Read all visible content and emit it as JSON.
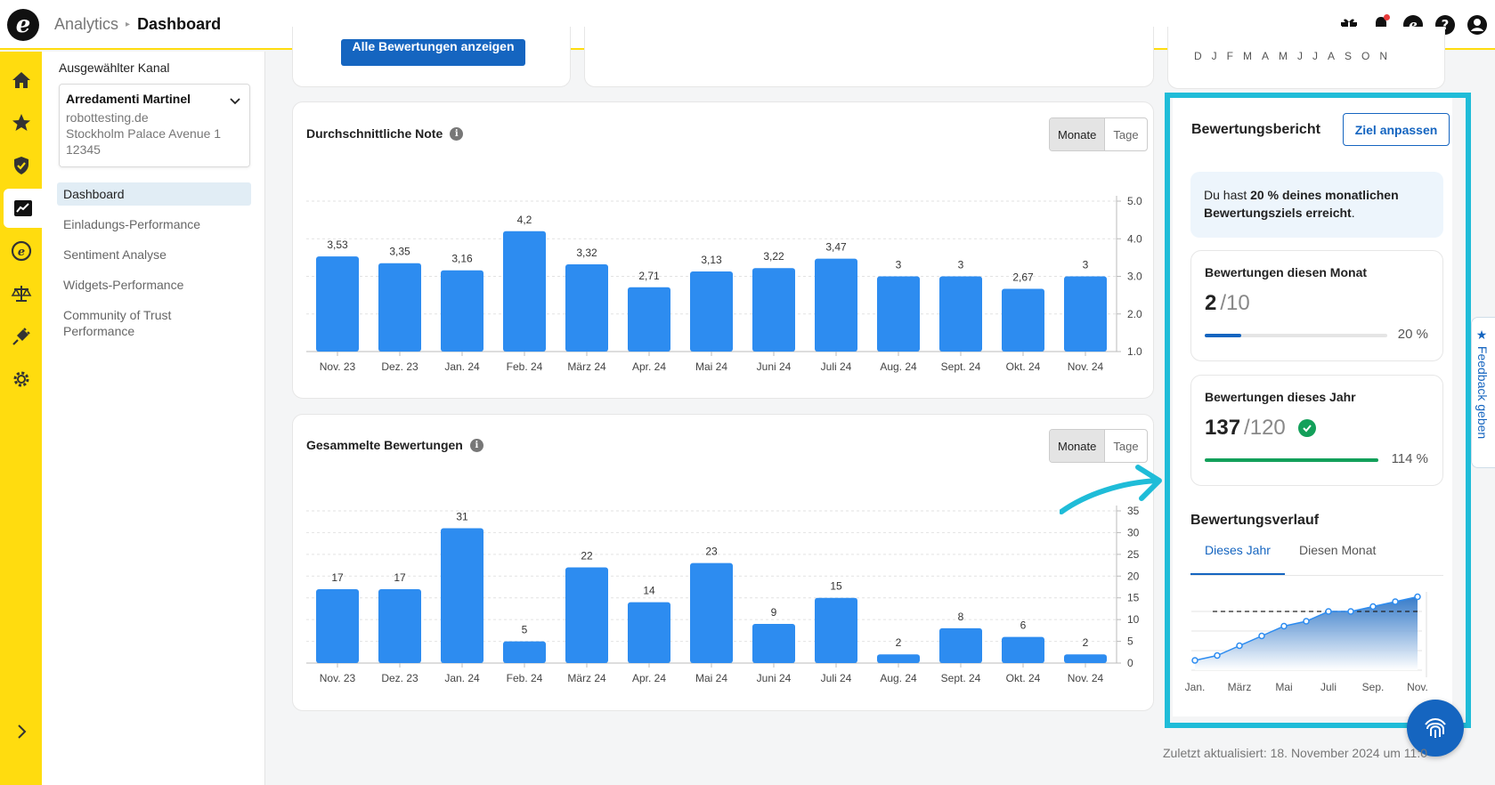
{
  "header": {
    "logo": "e",
    "breadcrumb": [
      "Analytics",
      "Dashboard"
    ],
    "icons": [
      "gift-icon",
      "bell-icon",
      "trustedshops-icon",
      "help-icon",
      "account-icon"
    ]
  },
  "rail": {
    "icons": [
      "home-icon",
      "star-icon",
      "shield-icon",
      "analytics-icon",
      "trustbadge-icon",
      "scales-icon",
      "plugin-icon",
      "settings-icon"
    ],
    "expand_icon": "chevron-right-icon"
  },
  "sidebar": {
    "label": "Ausgewählter Kanal",
    "channel": {
      "name": "Arredamenti Martinel",
      "lines": [
        "robottesting.de",
        "Stockholm Palace Avenue 1",
        "12345"
      ]
    },
    "nav": [
      "Dashboard",
      "Einladungs-Performance",
      "Sentiment Analyse",
      "Widgets-Performance",
      "Community of Trust Performance"
    ]
  },
  "top_partial": {
    "button_label": "Alle Bewertungen anzeigen",
    "month_letters": "DJFMAMJJASON"
  },
  "toggle": {
    "on": "Monate",
    "off": "Tage"
  },
  "colors": {
    "bar": "#2d8cf0",
    "accent": "#1565c0",
    "yellow": "#ffdc0f",
    "highlight": "#1fbcd8",
    "green": "#13a05a"
  },
  "chart_data": [
    {
      "type": "bar",
      "title": "Durchschnittliche Note",
      "categories": [
        "Nov. 23",
        "Dez. 23",
        "Jan. 24",
        "Feb. 24",
        "März 24",
        "Apr. 24",
        "Mai 24",
        "Juni 24",
        "Juli 24",
        "Aug. 24",
        "Sept. 24",
        "Okt. 24",
        "Nov. 24"
      ],
      "values": [
        3.53,
        3.35,
        3.16,
        4.2,
        3.32,
        2.71,
        3.13,
        3.22,
        3.47,
        3,
        3,
        2.67,
        3
      ],
      "labels": [
        "3,53",
        "3,35",
        "3,16",
        "4,2",
        "3,32",
        "2,71",
        "3,13",
        "3,22",
        "3,47",
        "3",
        "3",
        "2,67",
        "3"
      ],
      "yticks": [
        "1.0",
        "2.0",
        "3.0",
        "4.0",
        "5.0"
      ],
      "ylim": [
        1,
        5
      ]
    },
    {
      "type": "bar",
      "title": "Gesammelte Bewertungen",
      "categories": [
        "Nov. 23",
        "Dez. 23",
        "Jan. 24",
        "Feb. 24",
        "März 24",
        "Apr. 24",
        "Mai 24",
        "Juni 24",
        "Juli 24",
        "Aug. 24",
        "Sept. 24",
        "Okt. 24",
        "Nov. 24"
      ],
      "values": [
        17,
        17,
        31,
        5,
        22,
        14,
        23,
        9,
        15,
        2,
        8,
        6,
        2
      ],
      "labels": [
        "17",
        "17",
        "31",
        "5",
        "22",
        "14",
        "23",
        "9",
        "15",
        "2",
        "8",
        "6",
        "2"
      ],
      "yticks": [
        "0",
        "5",
        "10",
        "15",
        "20",
        "25",
        "30",
        "35"
      ],
      "ylim": [
        0,
        35
      ]
    },
    {
      "type": "area",
      "title": "Bewertungsverlauf",
      "x_ticks": [
        "Jan.",
        "März",
        "Mai",
        "Juli",
        "Sep.",
        "Nov."
      ],
      "values": [
        2,
        3,
        5,
        7,
        9,
        10,
        12,
        12,
        13,
        14,
        15
      ],
      "target_line": 12,
      "ylim": [
        0,
        16
      ]
    }
  ],
  "report": {
    "title": "Bewertungsbericht",
    "goal_button": "Ziel anpassen",
    "notice_prefix": "Du hast ",
    "notice_bold": "20 % deines monatlichen Bewertungsziels erreicht",
    "notice_suffix": ".",
    "month": {
      "label": "Bewertungen diesen Monat",
      "value": "2",
      "target": "/10",
      "pct_label": "20 %",
      "progress": 0.2
    },
    "year": {
      "label": "Bewertungen dieses Jahr",
      "value": "137",
      "target": "/120",
      "pct_label": "114 %",
      "progress": 1.0
    },
    "history_title": "Bewertungsverlauf",
    "tabs": [
      "Dieses Jahr",
      "Diesen Monat"
    ]
  },
  "feedback_label": "★ Feedback geben",
  "updated_text": "Zuletzt aktualisiert: 18. November 2024 um 11:0"
}
